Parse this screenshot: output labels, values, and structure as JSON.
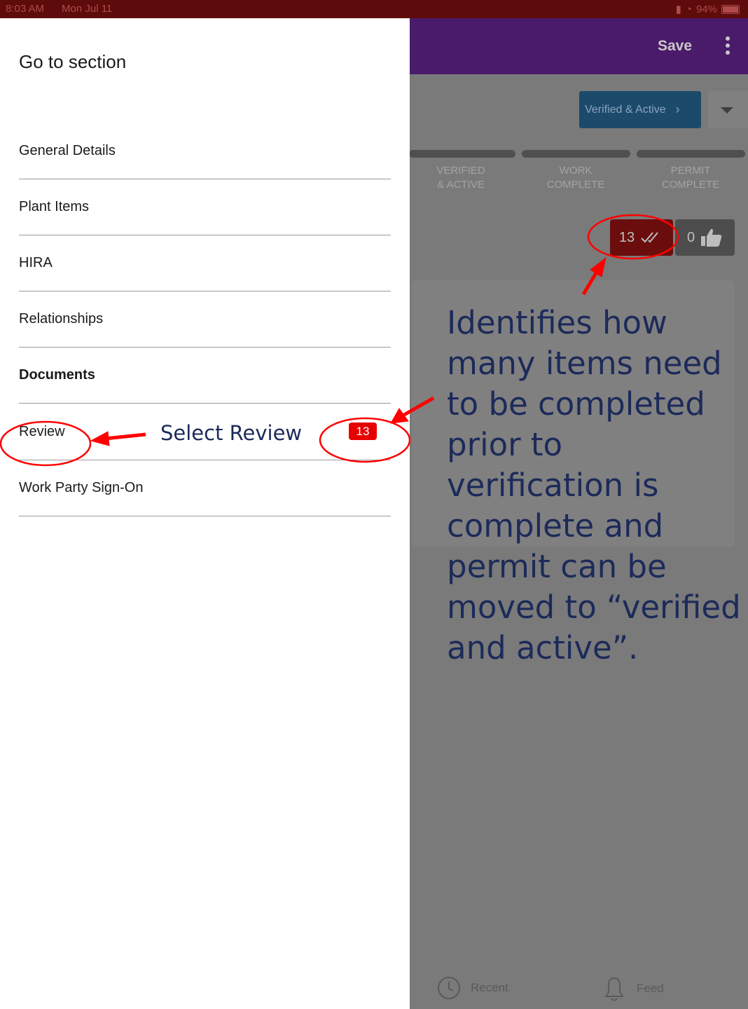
{
  "status_bar": {
    "time": "8:03 AM",
    "date": "Mon Jul 11",
    "battery": "94%"
  },
  "app_bar": {
    "save_label": "Save",
    "menu_icon": "kebab-menu-icon"
  },
  "status_button": {
    "label": "Verified & Active",
    "chevron": "›"
  },
  "progress_steps": [
    {
      "label_line1": "VERIFIED",
      "label_line2": "& ACTIVE"
    },
    {
      "label_line1": "WORK",
      "label_line2": "COMPLETE"
    },
    {
      "label_line1": "PERMIT",
      "label_line2": "COMPLETE"
    }
  ],
  "counters": {
    "pending_count": "13",
    "likes_count": "0"
  },
  "bottom_tabs": [
    {
      "label": "Recent",
      "icon": "clock-history-icon"
    },
    {
      "label": "Feed",
      "icon": "bell-icon"
    }
  ],
  "drawer": {
    "title": "Go to section",
    "items": [
      {
        "label": "General Details"
      },
      {
        "label": "Plant Items"
      },
      {
        "label": "HIRA"
      },
      {
        "label": "Relationships"
      },
      {
        "label": "Documents"
      },
      {
        "label": "Review",
        "badge": "13"
      },
      {
        "label": "Work Party Sign-On"
      }
    ]
  },
  "annotations": {
    "select_review": "Select Review",
    "callout": "Identifies how many items need to be completed prior to verification is complete and permit can be moved to “verified and active”."
  },
  "colors": {
    "annotation_red": "#ff0000",
    "annotation_text": "#1c2a5a",
    "badge_red": "#e60000",
    "app_bar": "#4a1a6b"
  }
}
